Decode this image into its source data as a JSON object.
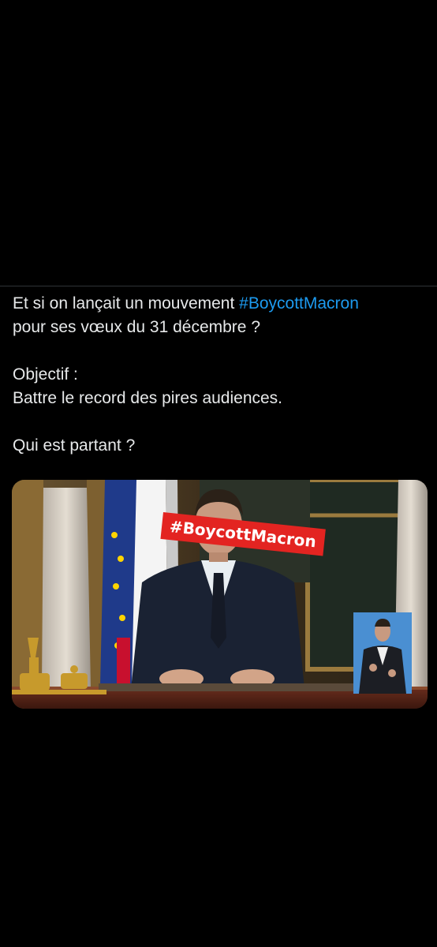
{
  "post": {
    "line1_prefix": "Et si on lançait un mouvement ",
    "line1_hashtag": "#BoycottMacron",
    "line2": "pour ses vœux du 31 décembre ?",
    "line3": "Objectif :",
    "line4": "Battre le record des pires audiences.",
    "line5": "Qui est partant ?"
  },
  "media": {
    "overlay_text": "#BoycottMacron",
    "overlay_color": "#e32421"
  },
  "colors": {
    "background": "#000000",
    "text": "#e7e9ea",
    "hashtag": "#1d9bf0"
  }
}
